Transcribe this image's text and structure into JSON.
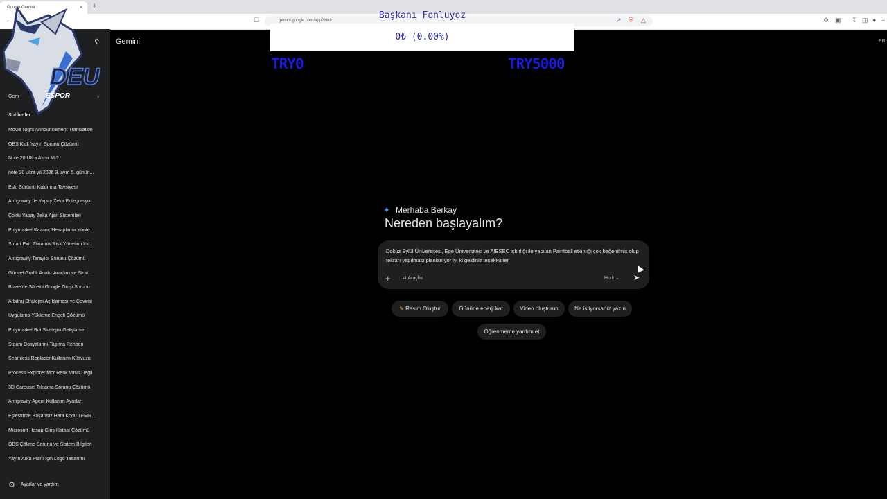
{
  "browser": {
    "tab_title": "Google Gemini",
    "tab_close": "×",
    "new_tab": "+",
    "url": "gemini.google.com/app?hl=tr"
  },
  "header": {
    "title": "Gemini",
    "badge": "PR"
  },
  "overlay": {
    "title": "Başkanı Fonluyoz",
    "amount": "0₺ (0.00%)",
    "min_label": "TRY0",
    "max_label": "TRY5000",
    "logo_text": "DEU",
    "logo_subtext": "ESPOR"
  },
  "sidebar": {
    "gem_label": "Gem",
    "section_title": "Sohbetler",
    "chats": [
      "Movie Night Announcement Translation",
      "OBS Kick Yayın Sorunu Çözümü",
      "Note 20 Ultra Alınır Mı?",
      "note 20 ultra yıl 2026 3. ayın 5. günün...",
      "Eski Sürümü Kaldırma Tavsiyesi",
      "Antigravity İle Yapay Zeka Entegrasyo...",
      "Çoklu Yapay Zeka Ajan Sistemleri",
      "Polymarket Kazanç Hesaplama Yönte...",
      "Smart Exit: Dinamik Risk Yönetimi İnc...",
      "Antigravity Tarayıcı Sorunu Çözümü",
      "Güncel Grafik Analiz Araçları ve Strat...",
      "Brave'de Sürekli Google Girişi Sorunu",
      "Arbitraj Stratejisi Açıklaması ve Çevirisi",
      "Uygulama Yükleme Engeli Çözümü",
      "Polymarket Bot Stratejisi Geliştirme",
      "Steam Dosyalarını Taşıma Rehberi",
      "Seamless Replacer Kullanım Kılavuzu",
      "Process Explorer Mor Renk Virüs Değil",
      "3D Carousel Tıklama Sorunu Çözümü",
      "Antigravity Agent Kullanım Ayarları",
      "Eşleştirme Başarısız Hata Kodu TFMR...",
      "Microsoft Hesap Giriş Hatası Çözümü",
      "OBS Çökme Sorunu ve Sistem Bilgileri",
      "Yayın Arka Planı İçin Logo Tasarımı"
    ],
    "settings_label": "Ayarlar ve yardım"
  },
  "main": {
    "greeting_name": "Merhaba Berkay",
    "greeting_title": "Nereden başlayalım?",
    "prompt_text": "Dokuz Eylül Üniversitesi, Ege Üniversitesi ve AIESEC işbirliği ile yapılan Paintball etkinliği çok beğenilmiş olup tekrarı yapılması planlanıyor iyi ki geldiniz teşekkürler",
    "tools_label": "Araçlar",
    "speed_label": "Hızlı",
    "chips": [
      "Resim Oluştur",
      "Gününe enerji kat",
      "Video oluşturun",
      "Ne istiyorsanız yazın",
      "Öğrenmeme yardım et"
    ]
  },
  "colors": {
    "background": "#000000",
    "sidebar": "#1e1f20",
    "overlay_text": "#1a1adb",
    "gemini_star": "#4b8bf5"
  }
}
